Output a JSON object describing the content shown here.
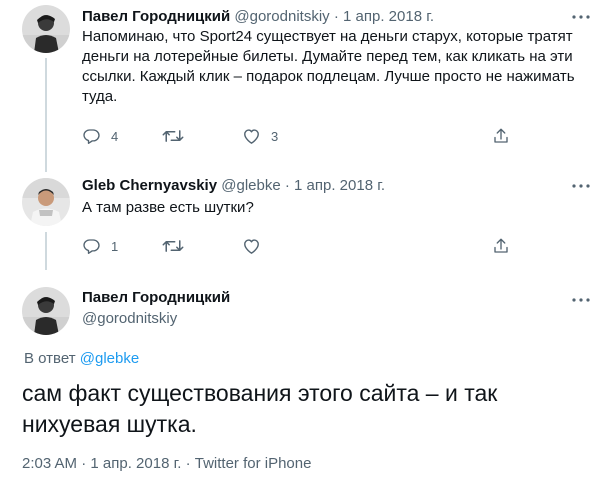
{
  "tweet1": {
    "name": "Павел Городницкий",
    "handle": "@gorodnitskiy",
    "sep": "·",
    "date": "1 апр. 2018 г.",
    "text": "Напоминаю, что Sport24 существует на деньги старух, которые тратят деньги на лотерейные билеты. Думайте перед тем, как кликать на эти ссылки. Каждый клик – подарок подлецам. Лучше просто не нажимать туда.",
    "reply_count": "4",
    "retweet_count": "",
    "like_count": "3"
  },
  "tweet2": {
    "name": "Gleb Chernyavskiy",
    "handle": "@glebke",
    "sep": "·",
    "date": "1 апр. 2018 г.",
    "text": "А там разве есть шутки?",
    "reply_count": "1",
    "retweet_count": "",
    "like_count": ""
  },
  "main_tweet": {
    "name": "Павел Городницкий",
    "handle": "@gorodnitskiy",
    "reply_prefix": "В ответ",
    "reply_to": "@glebke",
    "text": "сам факт существования этого сайта – и так нихуевая шутка.",
    "time": "2:03 AM",
    "date": "1 апр. 2018 г.",
    "source": "Twitter for iPhone",
    "sep": "·"
  },
  "icons": [
    "more-icon",
    "reply-icon",
    "retweet-icon",
    "like-icon",
    "share-icon"
  ],
  "colors": {
    "text": "#0f1419",
    "secondary": "#536471",
    "link": "#1d9bf0",
    "divider": "#eff3f4",
    "thread_line": "#cfd9de"
  }
}
